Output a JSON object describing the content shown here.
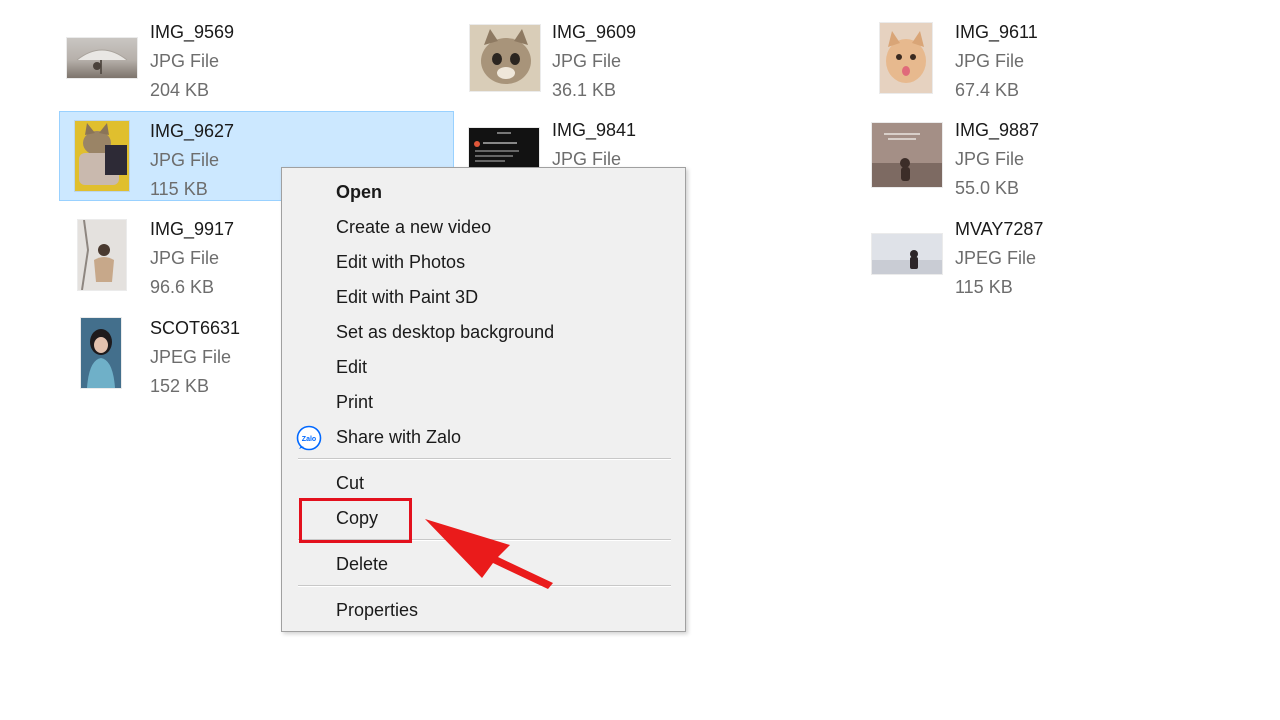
{
  "files": [
    {
      "name": "IMG_9569",
      "type": "JPG File",
      "size": "204 KB",
      "thumb": "umbrella-photo"
    },
    {
      "name": "IMG_9609",
      "type": "JPG File",
      "size": "36.1 KB",
      "thumb": "kitten-photo"
    },
    {
      "name": "IMG_9611",
      "type": "JPG File",
      "size": "67.4 KB",
      "thumb": "cat-tongue-photo"
    },
    {
      "name": "IMG_9627",
      "type": "JPG File",
      "size": "115 KB",
      "thumb": "cat-sweater-photo",
      "selected": true
    },
    {
      "name": "IMG_9841",
      "type": "JPG File",
      "size": "",
      "thumb": "dark-screenshot"
    },
    {
      "name": "IMG_9887",
      "type": "JPG File",
      "size": "55.0 KB",
      "thumb": "stairs-photo"
    },
    {
      "name": "IMG_9917",
      "type": "JPG File",
      "size": "96.6 KB",
      "thumb": "snow-photo"
    },
    {
      "name": "MVAY7287",
      "type": "JPEG File",
      "size": "115 KB",
      "thumb": "white-room-photo"
    },
    {
      "name": "SCOT6631",
      "type": "JPEG File",
      "size": "152 KB",
      "thumb": "portrait-photo"
    }
  ],
  "context_menu": {
    "open": "Open",
    "create_video": "Create a new video",
    "edit_photos": "Edit with Photos",
    "edit_paint3d": "Edit with Paint 3D",
    "set_background": "Set as desktop background",
    "edit": "Edit",
    "print": "Print",
    "share_zalo": "Share with Zalo",
    "zalo_icon_text": "Zalo",
    "cut": "Cut",
    "copy": "Copy",
    "delete": "Delete",
    "properties": "Properties"
  },
  "colors": {
    "selection": "#cce8ff",
    "selection_border": "#99d1ff",
    "menu_bg": "#f0f0f0",
    "highlight": "#e3101d",
    "zalo_blue": "#0068ff"
  }
}
